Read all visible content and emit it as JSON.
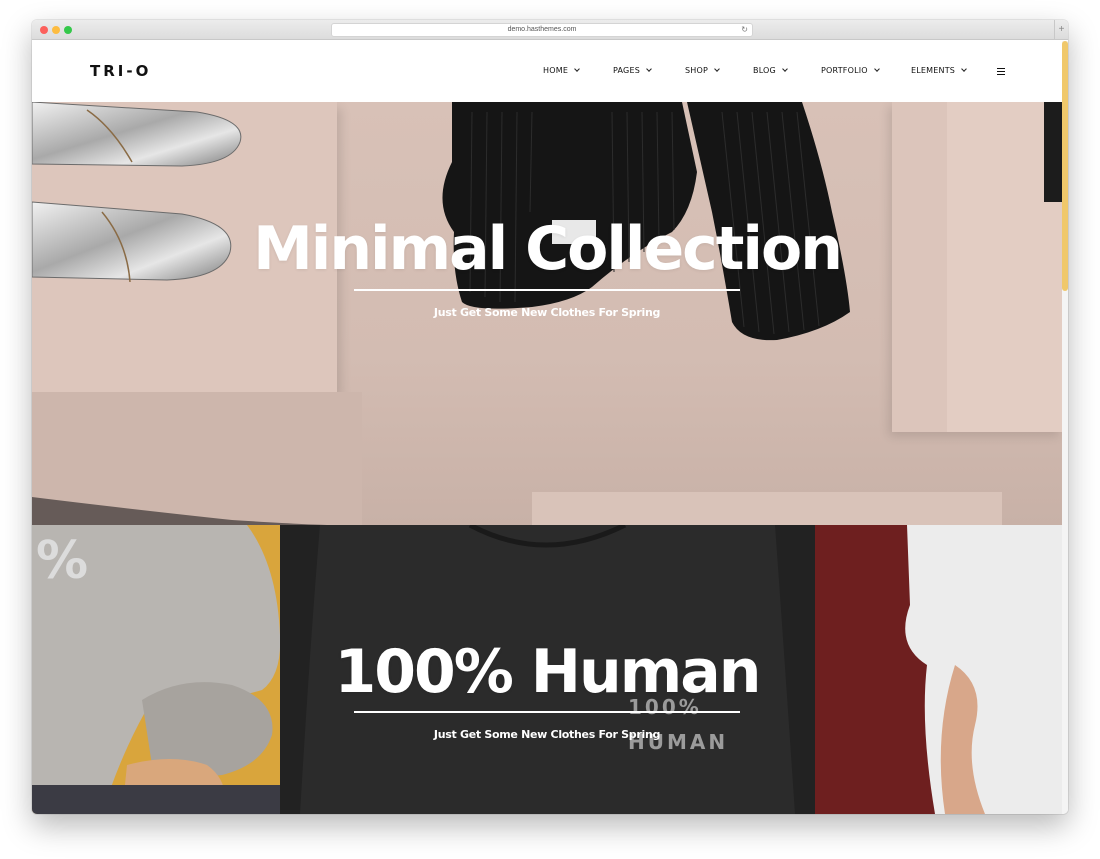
{
  "browser": {
    "url": "demo.hasthemes.com",
    "reload_icon": "reload-icon",
    "new_tab_icon": "plus-icon"
  },
  "header": {
    "logo": "TRI-O",
    "nav": [
      {
        "label": "HOME"
      },
      {
        "label": "PAGES"
      },
      {
        "label": "SHOP"
      },
      {
        "label": "BLOG"
      },
      {
        "label": "PORTFOLIO"
      },
      {
        "label": "ELEMENTS"
      }
    ],
    "menu_icon": "hamburger-icon"
  },
  "hero_primary": {
    "title": "Minimal Collection",
    "subtitle": "Just Get Some New Clothes For Spring"
  },
  "hero_secondary": {
    "title": "100% Human",
    "subtitle": "Just Get Some New Clothes For Spring",
    "shirt_print_line1": "100%",
    "shirt_print_line2": "HUMAN",
    "sweater_print": "%"
  },
  "colors": {
    "accent_scroll": "#f0c86b",
    "hero_bg": "#d6bfb5",
    "mustard": "#d9a53c",
    "maroon": "#6e1f1f"
  }
}
